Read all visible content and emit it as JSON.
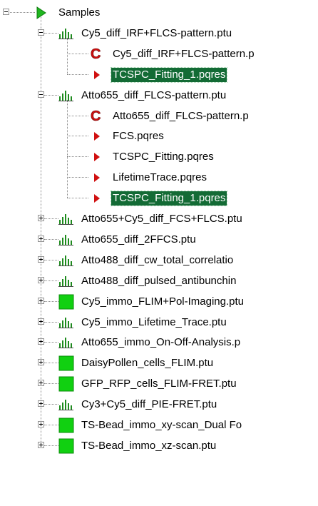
{
  "tree": {
    "root": {
      "label": "Samples",
      "icon": "green-play-icon",
      "expanded": true
    },
    "children": [
      {
        "label": "Cy5_diff_IRF+FLCS-pattern.ptu",
        "icon": "bar-histogram-icon",
        "expanded": true,
        "children": [
          {
            "label": "Cy5_diff_IRF+FLCS-pattern.p",
            "icon": "red-c-icon"
          },
          {
            "label": "TCSPC_Fitting_1.pqres",
            "icon": "red-triangle-icon",
            "selected": true
          }
        ]
      },
      {
        "label": "Atto655_diff_FLCS-pattern.ptu",
        "icon": "bar-histogram-icon",
        "expanded": true,
        "children": [
          {
            "label": "Atto655_diff_FLCS-pattern.p",
            "icon": "red-c-icon"
          },
          {
            "label": "FCS.pqres",
            "icon": "red-triangle-icon"
          },
          {
            "label": "TCSPC_Fitting.pqres",
            "icon": "red-triangle-icon"
          },
          {
            "label": "LifetimeTrace.pqres",
            "icon": "red-triangle-icon"
          },
          {
            "label": "TCSPC_Fitting_1.pqres",
            "icon": "red-triangle-icon",
            "selected": true
          }
        ]
      },
      {
        "label": "Atto655+Cy5_diff_FCS+FLCS.ptu",
        "icon": "bar-histogram-icon",
        "expanded": false
      },
      {
        "label": "Atto655_diff_2FFCS.ptu",
        "icon": "bar-histogram-icon",
        "expanded": false
      },
      {
        "label": "Atto488_diff_cw_total_correlatio",
        "icon": "bar-histogram-icon",
        "expanded": false
      },
      {
        "label": "Atto488_diff_pulsed_antibunchin",
        "icon": "bar-histogram-icon",
        "expanded": false
      },
      {
        "label": "Cy5_immo_FLIM+Pol-Imaging.ptu",
        "icon": "green-square-icon",
        "expanded": false
      },
      {
        "label": "Cy5_immo_Lifetime_Trace.ptu",
        "icon": "bar-histogram-icon",
        "expanded": false
      },
      {
        "label": "Atto655_immo_On-Off-Analysis.p",
        "icon": "bar-histogram-icon",
        "expanded": false
      },
      {
        "label": "DaisyPollen_cells_FLIM.ptu",
        "icon": "green-square-icon",
        "expanded": false
      },
      {
        "label": "GFP_RFP_cells_FLIM-FRET.ptu",
        "icon": "green-square-icon",
        "expanded": false
      },
      {
        "label": "Cy3+Cy5_diff_PIE-FRET.ptu",
        "icon": "bar-histogram-icon",
        "expanded": false
      },
      {
        "label": "TS-Bead_immo_xy-scan_Dual Fo",
        "icon": "green-square-icon",
        "expanded": false
      },
      {
        "label": "TS-Bead_immo_xz-scan.ptu",
        "icon": "green-square-icon",
        "expanded": false
      }
    ]
  },
  "colors": {
    "selection_background": "#136b35",
    "selection_text": "#ffffff",
    "play_icon": "#1fb61f",
    "square_icon": "#11d011",
    "histogram_icon": "#1e8b1e",
    "red_icon": "#d01010"
  }
}
